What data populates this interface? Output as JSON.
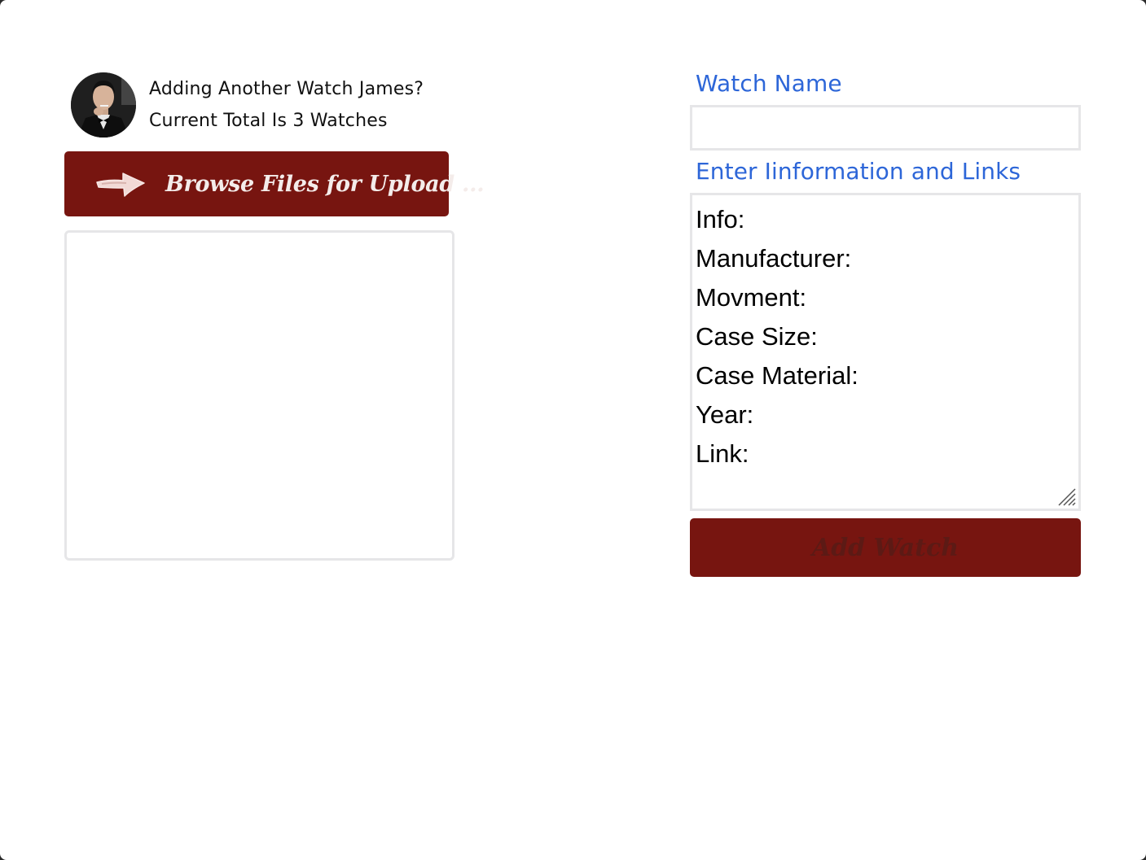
{
  "profile": {
    "greeting_line1": "Adding Another Watch James?",
    "greeting_line2": "Current Total Is 3 Watches",
    "avatar_icon": "user-avatar-photo"
  },
  "upload": {
    "browse_label": "Browse Files for Upload ...",
    "browse_icon": "arrow-right-icon",
    "button_color": "#771510"
  },
  "form": {
    "watch_name_label": "Watch Name",
    "watch_name_value": "",
    "info_label": "Enter Iinformation and Links",
    "info_lines": [
      "Info:",
      "Manufacturer:",
      "Movment:",
      "Case Size:",
      "Case Material:",
      "Year:",
      "Link:"
    ],
    "label_color": "#2d66d8",
    "add_button_label": "Add Watch"
  }
}
